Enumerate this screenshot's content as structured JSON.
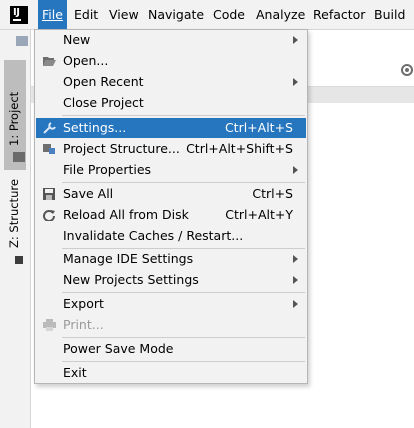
{
  "menubar": {
    "items": [
      "File",
      "Edit",
      "View",
      "Navigate",
      "Code",
      "Analyze",
      "Refactor",
      "Build"
    ]
  },
  "tool_windows": {
    "project": "1: Project",
    "structure": "Z: Structure"
  },
  "file_menu": {
    "items": [
      {
        "label": "New",
        "shortcut": "",
        "submenu": true
      },
      {
        "label": "Open...",
        "shortcut": "",
        "submenu": false,
        "icon": "folder-open-icon"
      },
      {
        "label": "Open Recent",
        "shortcut": "",
        "submenu": true
      },
      {
        "label": "Close Project",
        "shortcut": "",
        "submenu": false
      },
      {
        "label": "Settings...",
        "shortcut": "Ctrl+Alt+S",
        "submenu": false,
        "icon": "wrench-icon",
        "selected": true
      },
      {
        "label": "Project Structure...",
        "shortcut": "Ctrl+Alt+Shift+S",
        "submenu": false,
        "icon": "project-structure-icon"
      },
      {
        "label": "File Properties",
        "shortcut": "",
        "submenu": true
      },
      {
        "label": "Save All",
        "shortcut": "Ctrl+S",
        "submenu": false,
        "icon": "save-icon"
      },
      {
        "label": "Reload All from Disk",
        "shortcut": "Ctrl+Alt+Y",
        "submenu": false,
        "icon": "reload-icon"
      },
      {
        "label": "Invalidate Caches / Restart...",
        "shortcut": "",
        "submenu": false
      },
      {
        "label": "Manage IDE Settings",
        "shortcut": "",
        "submenu": true
      },
      {
        "label": "New Projects Settings",
        "shortcut": "",
        "submenu": true
      },
      {
        "label": "Export",
        "shortcut": "",
        "submenu": true
      },
      {
        "label": "Print...",
        "shortcut": "",
        "submenu": false,
        "icon": "print-icon",
        "disabled": true
      },
      {
        "label": "Power Save Mode",
        "shortcut": "",
        "submenu": false
      },
      {
        "label": "Exit",
        "shortcut": "",
        "submenu": false
      }
    ]
  },
  "colors": {
    "accent": "#2675bf",
    "menu_bg": "#f2f2f2",
    "disabled_text": "#9a9a9a"
  }
}
